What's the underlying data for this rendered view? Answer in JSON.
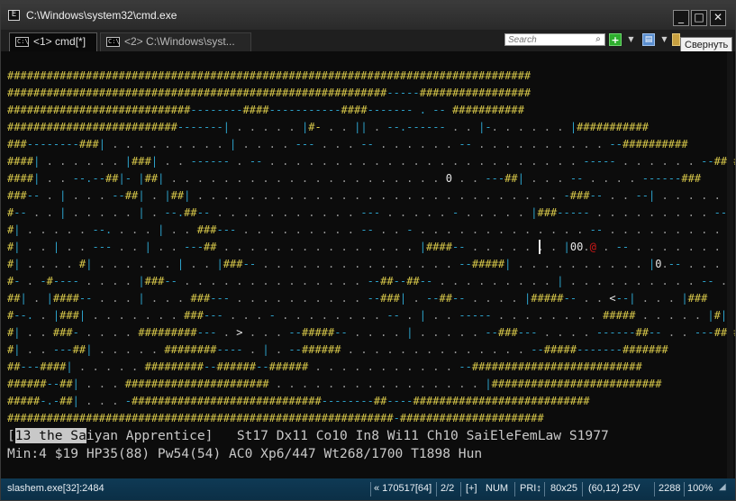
{
  "window": {
    "title": "C:\\Windows\\system32\\cmd.exe",
    "minimize_label": "_",
    "maximize_label": "□",
    "close_label": "✕"
  },
  "tabs": [
    {
      "label": "<1> cmd[*]",
      "active": true
    },
    {
      "label": "<2> C:\\Windows\\syst...",
      "active": false
    }
  ],
  "toolbar": {
    "search_placeholder": "Search",
    "add_label": "+",
    "tooltip": "Свернуть"
  },
  "game": {
    "status_name_highlight": "13 the Sa",
    "status_name_rest": "iyan Apprentice]",
    "status_line1_prefix": "[",
    "status_line1_stats": "   St17 Dx11 Co10 In8 Wi11 Ch10 SaiEleFemLaw S1977",
    "status_line2": "Min:4 $19 HP35(88) Pw54(54) AC0 Xp6/447 Wt268/1700 T1898 Hun"
  },
  "statusbar": {
    "process": "slashem.exe[32]:2484",
    "buffer": "« 170517[64]",
    "pane": "2/2",
    "ins": "[+]",
    "num": "NUM",
    "pri": "PRI↕",
    "size": "80x25",
    "cursor": "(60,12) 25V",
    "pid": "2288",
    "zoom": "100%"
  },
  "colors": {
    "wall": "#d8c84a",
    "corridor": "#2ca0c8",
    "floor": "#9a9a9a",
    "statusbar_bg": "#0f3a55"
  }
}
